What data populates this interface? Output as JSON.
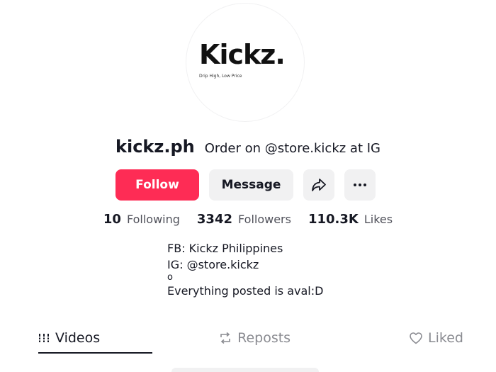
{
  "profile": {
    "avatar_brand": "Kickz.",
    "avatar_tagline": "Drip High, Low Price",
    "username": "kickz.ph",
    "nickname": "Order on @store.kickz at IG"
  },
  "actions": {
    "follow_label": "Follow",
    "message_label": "Message",
    "share_icon": "share-icon",
    "more_icon": "more-icon"
  },
  "stats": [
    {
      "value": "10",
      "label": "Following"
    },
    {
      "value": "3342",
      "label": "Followers"
    },
    {
      "value": "110.3K",
      "label": "Likes"
    }
  ],
  "bio": {
    "line1": "FB: Kickz Philippines",
    "line2": "IG: @store.kickz",
    "line3": "o",
    "line4": "Everything posted is aval:D"
  },
  "tabs": [
    {
      "label": "Videos",
      "icon": "grid-icon",
      "active": true
    },
    {
      "label": "Reposts",
      "icon": "repost-icon",
      "active": false
    },
    {
      "label": "Liked",
      "icon": "heart-icon",
      "active": false
    }
  ],
  "colors": {
    "follow": "#fe2c55",
    "secondary_button": "#f1f1f2",
    "text_primary": "#161823",
    "text_secondary": "#50515a",
    "tab_inactive": "#8a8b91"
  }
}
